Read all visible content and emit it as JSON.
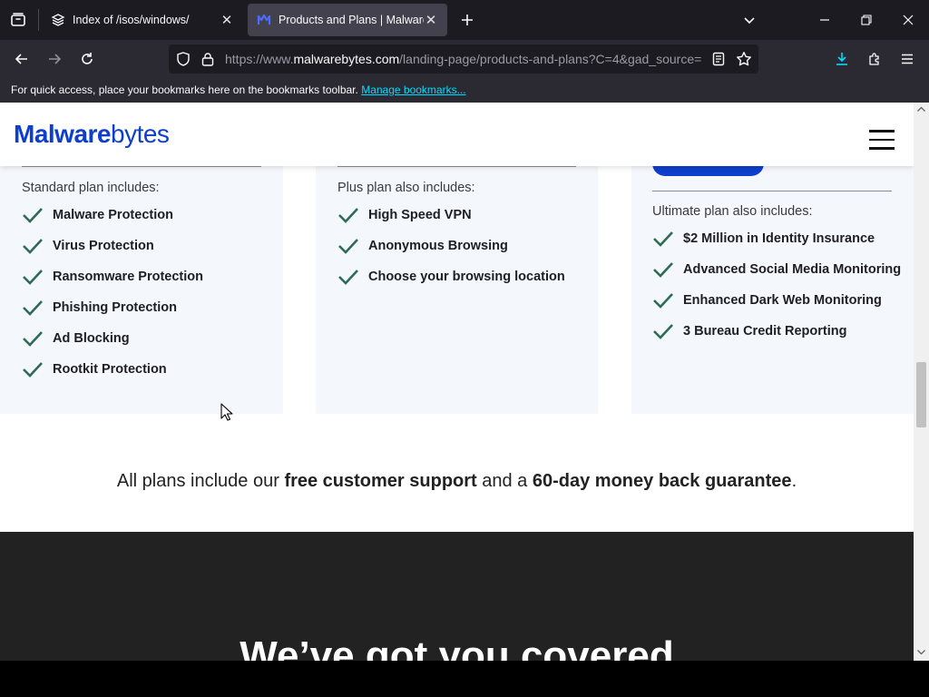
{
  "browser": {
    "tabs": [
      {
        "title": "Index of /isos/windows/",
        "active": false,
        "icon": "stack-icon"
      },
      {
        "title": "Products and Plans | Malwareby",
        "active": true,
        "icon": "malwarebytes-icon"
      }
    ],
    "url": {
      "prefix": "https://www.",
      "domain": "malwarebytes.com",
      "path": "/landing-page/products-and-plans?C=4&gad_source="
    },
    "bookmarks_bar": {
      "message": "For quick access, place your bookmarks here on the bookmarks toolbar.",
      "link": "Manage bookmarks..."
    },
    "colors": {
      "tab_bg": "#1c1b22",
      "toolbar_bg": "#2b2a33",
      "link": "#00ddff",
      "download_accent": "#00ddff"
    }
  },
  "site": {
    "logo": {
      "part1": "Malware",
      "part2": "bytes"
    },
    "brand_color": "#0d3ecc",
    "plans": [
      {
        "heading": "Standard plan includes:",
        "features": [
          "Malware Protection",
          "Virus Protection",
          "Ransomware Protection",
          "Phishing Protection",
          "Ad Blocking",
          "Rootkit Protection"
        ]
      },
      {
        "heading": "Plus plan also includes:",
        "features": [
          "High Speed VPN",
          "Anonymous Browsing",
          "Choose your browsing location"
        ]
      },
      {
        "heading": "Ultimate plan also includes:",
        "features": [
          "$2 Million in Identity Insurance",
          "Advanced Social Media Monitoring",
          "Enhanced Dark Web Monitoring",
          "3 Bureau Credit Reporting"
        ]
      }
    ],
    "guarantee": {
      "pre": "All plans include our ",
      "b1": "free customer support",
      "mid": " and a ",
      "b2": "60-day money back guarantee",
      "post": "."
    },
    "covered_heading": "We’ve got you covered",
    "check_color": "#2e6b55"
  }
}
